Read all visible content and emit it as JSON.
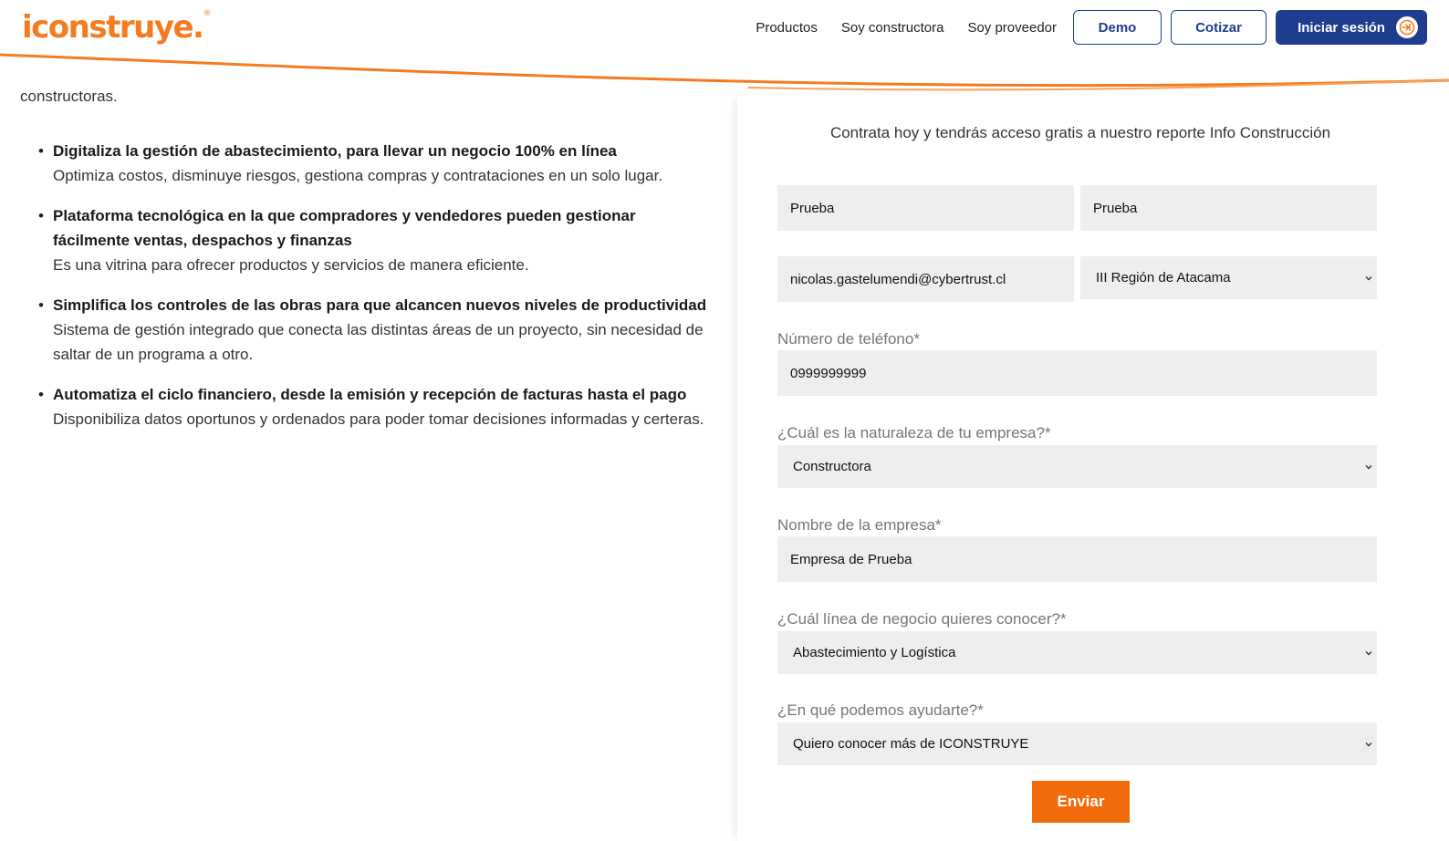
{
  "brand": {
    "logo_text": "iconstruye.",
    "registered": "®",
    "color": "#f47b20"
  },
  "nav": {
    "links": [
      "Productos",
      "Soy constructora",
      "Soy proveedor"
    ],
    "demo_label": "Demo",
    "quote_label": "Cotizar",
    "login_label": "Iniciar sesión",
    "login_icon": "login-arrow-icon",
    "accent_color": "#1f3d8f"
  },
  "left": {
    "cut_text": "constructoras.",
    "features": [
      {
        "title": "Digitaliza la gestión de abastecimiento, para llevar un negocio 100% en línea",
        "desc": "Optimiza costos, disminuye riesgos, gestiona compras y contrataciones en un solo lugar."
      },
      {
        "title": "Plataforma tecnológica en la que compradores y vendedores pueden gestionar fácilmente ventas, despachos y finanzas",
        "desc": "Es una vitrina para ofrecer productos y servicios de manera eficiente."
      },
      {
        "title": "Simplifica los controles de las obras para que alcancen nuevos niveles de productividad",
        "desc": "Sistema de gestión integrado que conecta las distintas áreas de un proyecto, sin necesidad de saltar de un programa a otro."
      },
      {
        "title": "Automatiza el ciclo financiero, desde la emisión y recepción de facturas hasta el pago",
        "desc": "Disponibiliza datos oportunos y ordenados para poder tomar decisiones informadas y certeras."
      }
    ]
  },
  "form": {
    "promo": "Contrata hoy y tendrás acceso gratis a nuestro reporte Info Construcción",
    "first_name": "Prueba",
    "last_name": "Prueba",
    "email": "nicolas.gastelumendi@cybertrust.cl",
    "region": "III Región de Atacama",
    "phone_label": "Número de teléfono*",
    "phone": "0999999999",
    "nature_label": "¿Cuál es la naturaleza de tu empresa?*",
    "nature": "Constructora",
    "company_label": "Nombre de la empresa*",
    "company": "Empresa de Prueba",
    "business_label": "¿Cuál línea de negocio quieres conocer?*",
    "business": "Abastecimiento y Logística",
    "help_label": "¿En qué podemos ayudarte?*",
    "help": "Quiero conocer más de ICONSTRUYE",
    "submit_label": "Enviar",
    "submit_color": "#f26b0a",
    "field_bg": "#eeeeee"
  }
}
